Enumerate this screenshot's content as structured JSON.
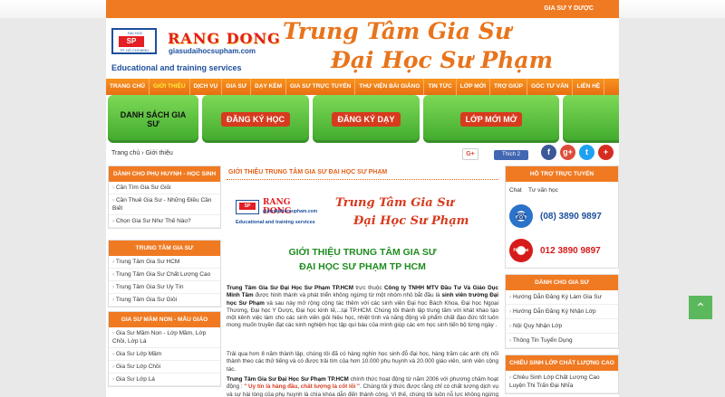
{
  "topbar": {
    "label": "GIA SƯ Y DƯỢC"
  },
  "logo": {
    "seal_top": "ĐẠI HỌC",
    "seal_letters": "SP",
    "seal_bottom": "TP. HỒ CHÍ MINH",
    "brand": "RANG DONG",
    "site": "giasudaihocsupham.com",
    "tagline": "Educational and training services"
  },
  "header": {
    "title_line1": "Trung Tâm Gia Sư",
    "title_line2": "Đại Học Sư Phạm"
  },
  "nav": [
    "TRANG CHỦ",
    "GIỚI THIỆU",
    "DỊCH VỤ",
    "GIA SƯ",
    "DẠY KÈM",
    "GIA SƯ TRỰC TUYẾN",
    "THƯ VIỆN BÀI GIẢNG",
    "TIN TỨC",
    "LỚP MỚI",
    "TRỢ GIÚP",
    "GÓC TƯ VẤN",
    "LIÊN HỆ"
  ],
  "banner": {
    "tile1": "DANH SÁCH GIA SƯ",
    "tile2": "ĐĂNG KÝ HỌC",
    "tile3": "ĐĂNG KÝ DẠY",
    "tile4": "LỚP MỚI MỞ"
  },
  "breadcrumb": "Trang chủ › Giới thiệu",
  "social": {
    "gplus": "G+",
    "like": "Thích 2",
    "fb": "f",
    "gp": "g+",
    "tw": "t",
    "more": "+"
  },
  "sidebar": {
    "box1": {
      "title": "DÀNH CHO PHỤ HUYNH - HỌC SINH",
      "items": [
        "Cần Tìm Gia Sư Giỏi",
        "Cần Thuê Gia Sư - Những Điều Cần Biết",
        "Chọn Gia Sư Như Thế Nào?"
      ]
    },
    "box2": {
      "title": "TRUNG TÂM GIA SƯ",
      "items": [
        "Trung Tâm Gia Sư HCM",
        "Trung Tâm Gia Sư Chất Lượng Cao",
        "Trung Tâm Gia Sư Uy Tín",
        "Trung Tâm Gia Sư Giỏi"
      ]
    },
    "box3": {
      "title": "GIA SƯ MẦM NON - MẪU GIÁO",
      "items": [
        "Gia Sư Mầm Non - Lớp Mầm, Lớp Chồi, Lớp Lá",
        "Gia Sư Lớp Mầm",
        "Gia Sư Lớp Chồi",
        "Gia Sư Lớp Lá"
      ]
    }
  },
  "main": {
    "heading": "GIỚI THIỆU TRUNG TÂM GIA SƯ ĐẠI HỌC SƯ PHẠM",
    "intro_line1": "GIỚI THIỆU TRUNG TÂM GIA SƯ",
    "intro_line2": "ĐẠI HỌC SƯ PHẠM TP HCM",
    "para1_a": "Trung Tâm Gia Sư Đại Học Sư Phạm TP.HCM",
    "para1_b": " trực thuộc ",
    "para1_c": "Công ty TNHH MTV Đầu Tư Và Giáo Dục Minh Tâm",
    "para1_d": " được hình thành và phát triển không ngừng từ một nhóm nhỏ bắt đầu là ",
    "para1_e": "sinh viên trường Đại học Sư Phạm",
    "para1_f": " và sau này mở rộng cộng tác thêm với các sinh viên Đại học Bách Khoa, Đại học Ngoại Thương, Đại học Y Dược, Đại học kinh tế,...tại TP.HCM. Chúng tôi thành lập trung tâm với khát khao tạo một kênh việc làm cho các sinh viên giỏi hiệu học, nhiệt tình và năng động về phẩm chất đạo đức tốt luôn mong muốn truyền đạt các kinh nghiệm học tập quí báu của mình giúp các em học sinh tiến bộ từng ngày .",
    "para2": "Trải qua hơn 8 năm thành lập, chúng tôi đã có hàng nghìn học sinh đỗ đại học, hàng trăm các anh chị nối thành theo các thử tiếng và có được trải tìm của hơn 10.000 phụ huynh và 20.000 giáo viên, sinh viên cộng tác.",
    "para3_a": "Trung Tâm Gia Sư Đại Học Sư Phạm TP.HCM",
    "para3_b": " chính thức hoạt động từ năm 2006 với phương châm hoạt động : ",
    "para3_c": "\" Uy tín là hàng đầu, chất lượng là cốt lõi \"",
    "para3_d": ". Chúng tôi ý thức được rằng chỉ có chất lượng dịch vụ và sự hài lòng của phụ huynh là chìa khóa dẫn đến thành công. Vì thế, chúng tôi luôn nỗ lực không ngừng để hoàn thiện mình bằng việc nâng cao trách nhiệm và khả năng tập huấn phương pháp sư phạm cho gia sư đồng thời luôn tuyển chọn đội ngũ gia sư chất lượng"
  },
  "right": {
    "support_title": "HỖ TRỢ TRỰC TUYẾN",
    "chat_img": "Chat",
    "chat_label": "Tư vấn học",
    "phone1": "(08) 3890 9897",
    "hotline_badge": "Hotline",
    "phone2": "012 3890 9897",
    "tutor_title": "DÀNH CHO GIA SƯ",
    "tutor_items": [
      "Hướng Dẫn Đăng Ký Làm Gia Sư",
      "Hướng Dẫn Đăng Ký Nhận Lớp",
      "Nội Quy Nhận Lớp",
      "Thông Tin Tuyển Dụng"
    ],
    "policy_title": "CHIÊU SINH LỚP CHẤT LƯỢNG CAO",
    "policy_items": [
      "Chiêu Sinh Lớp Chất Lượng Cao Luyện Thi Trấn Đại Nhĩa"
    ]
  },
  "scroll_top": "⌃",
  "colors": {
    "accent": "#f07a22",
    "nav": "#e86e13",
    "green": "#1f8c1f",
    "brand_blue": "#1d4f9c",
    "brand_red": "#e31e24"
  }
}
